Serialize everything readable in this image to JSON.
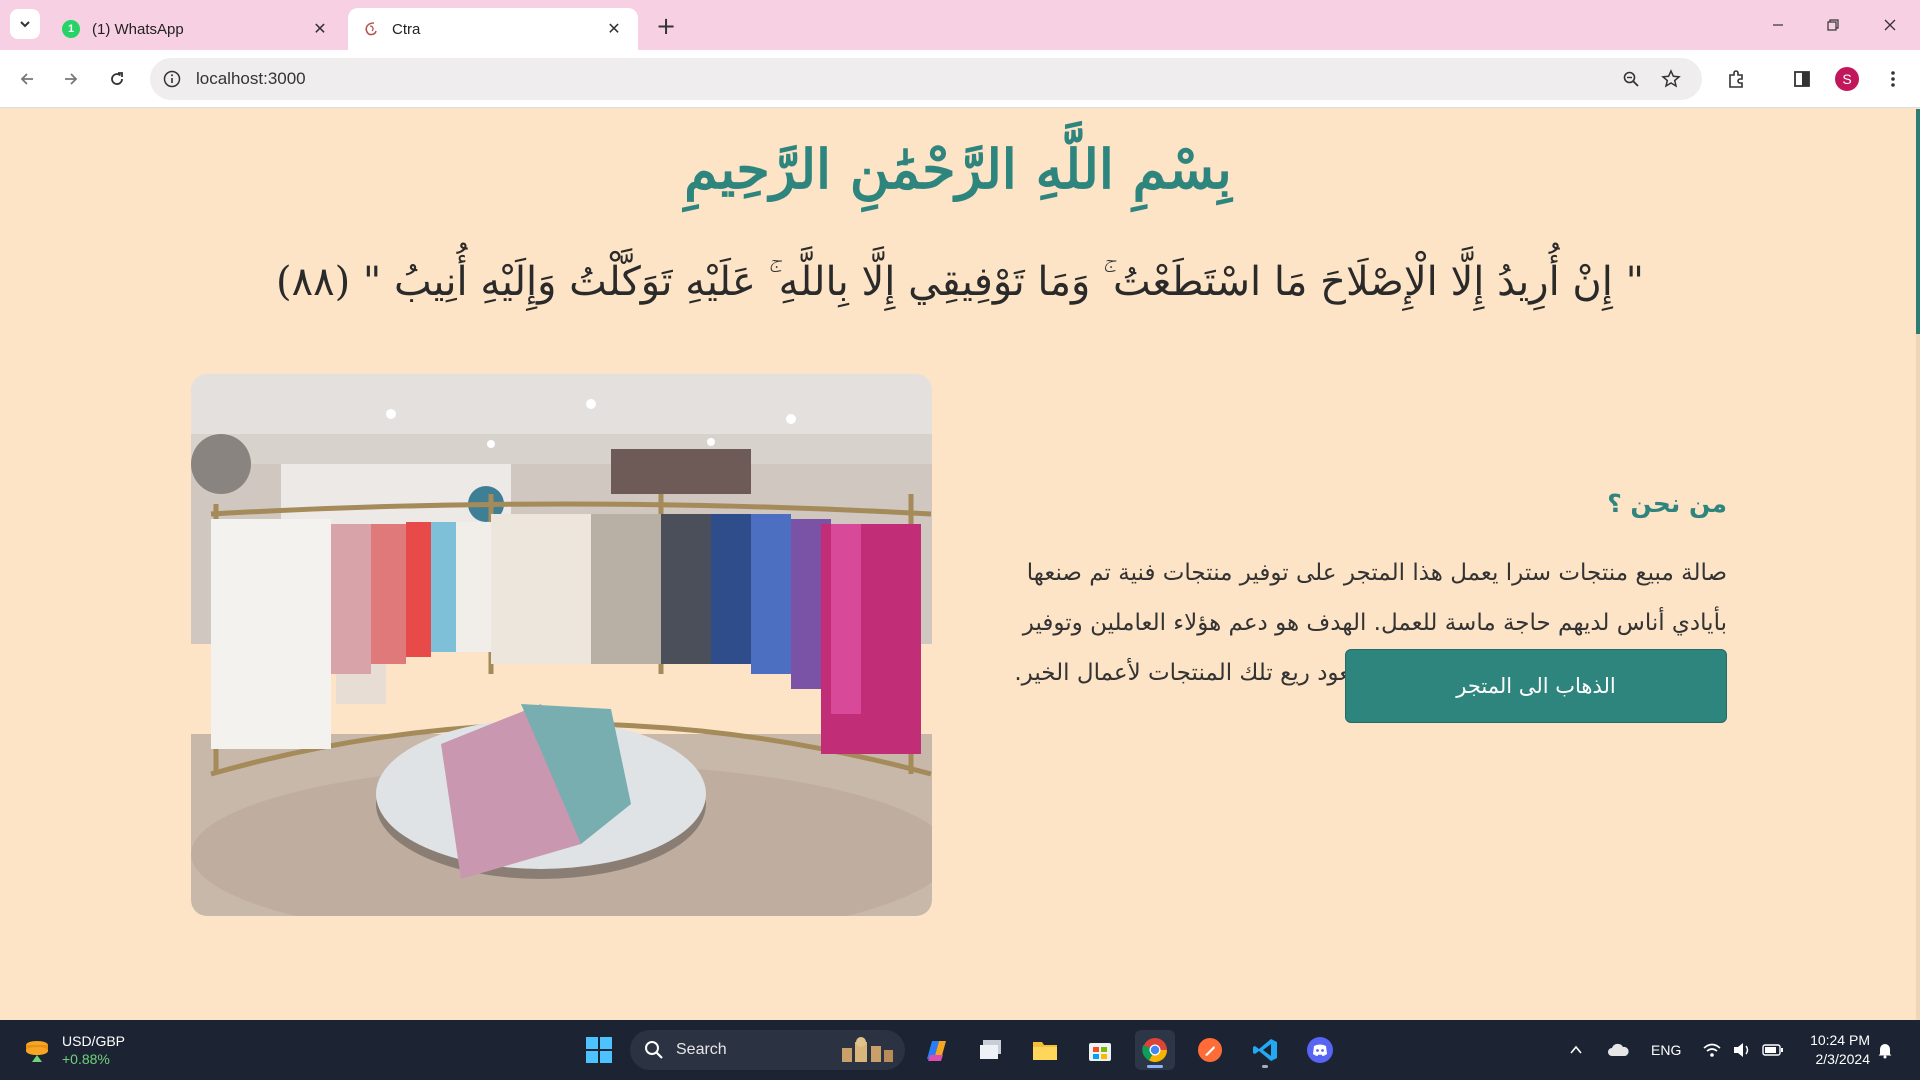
{
  "browser": {
    "tabs": [
      {
        "title": "(1) WhatsApp",
        "badge": "1",
        "active": false
      },
      {
        "title": "Ctra",
        "active": true
      }
    ],
    "url": "localhost:3000",
    "profile_initial": "S"
  },
  "page": {
    "basmala": "بِسْمِ اللَّهِ الرَّحْمَٰنِ الرَّحِيمِ",
    "verse": "\" إِنْ أُرِيدُ إِلَّا الْإِصْلَاحَ مَا اسْتَطَعْتُ ۚ وَمَا تَوْفِيقِي إِلَّا بِاللَّهِ ۚ عَلَيْهِ تَوَكَّلْتُ وَإِلَيْهِ أُنِيبُ \" (٨٨)",
    "about_title": "من نحن ؟",
    "about_text": "صالة مبيع منتجات سترا يعمل هذا المتجر على توفير منتجات فنية تم صنعها بأيادي أناس لديهم حاجة ماسة للعمل. الهدف هو دعم هؤلاء العاملين وتوفير منتجات فريدة وجودة عالية للزبائن كما يعود ريع تلك المنتجات لأعمال الخير.",
    "shop_button": "الذهاب الى المتجر"
  },
  "taskbar": {
    "ticker_name": "USD/GBP",
    "ticker_change": "+0.88%",
    "search_label": "Search",
    "language": "ENG",
    "time": "10:24 PM",
    "date": "2/3/2024"
  },
  "colors": {
    "page_bg": "#fde4c7",
    "accent": "#2e857e",
    "tabstrip": "#f7d1e3",
    "taskbar": "#1c2433"
  }
}
